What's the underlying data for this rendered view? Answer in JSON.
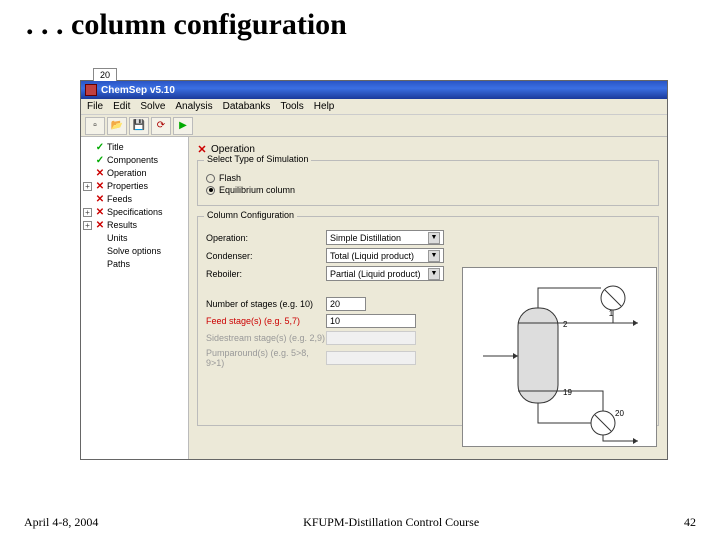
{
  "slide": {
    "title": ". . . column configuration",
    "footer_left": "April 4-8, 2004",
    "footer_center": "KFUPM-Distillation Control Course",
    "footer_right": "42"
  },
  "app": {
    "title": "ChemSep v5.10",
    "menu": [
      "File",
      "Edit",
      "Solve",
      "Analysis",
      "Databanks",
      "Tools",
      "Help"
    ],
    "tab_label": "20",
    "tree": {
      "title": "Title",
      "components": "Components",
      "operation": "Operation",
      "properties": "Properties",
      "feeds": "Feeds",
      "specifications": "Specifications",
      "results": "Results",
      "units": "Units",
      "solve_options": "Solve options",
      "paths": "Paths"
    },
    "panel": {
      "header": "Operation",
      "group1_legend": "Select Type of Simulation",
      "radio_flash": "Flash",
      "radio_equil": "Equilibrium column",
      "group2_legend": "Column Configuration",
      "rows": {
        "operation_lbl": "Operation:",
        "operation_val": "Simple Distillation",
        "condenser_lbl": "Condenser:",
        "condenser_val": "Total (Liquid product)",
        "reboiler_lbl": "Reboiler:",
        "reboiler_val": "Partial (Liquid product)",
        "stages_lbl": "Number of stages (e.g. 10)",
        "stages_val": "20",
        "feed_lbl": "Feed stage(s) (e.g. 5,7)",
        "feed_val": "10",
        "side_lbl": "Sidestream stage(s) (e.g. 2,9)",
        "side_val": "",
        "pump_lbl": "Pumparound(s) (e.g. 5>8, 9>1)",
        "pump_val": ""
      },
      "diagram_labels": {
        "top": "2",
        "bottom": "19",
        "cond": "1",
        "reb": "20"
      }
    }
  }
}
